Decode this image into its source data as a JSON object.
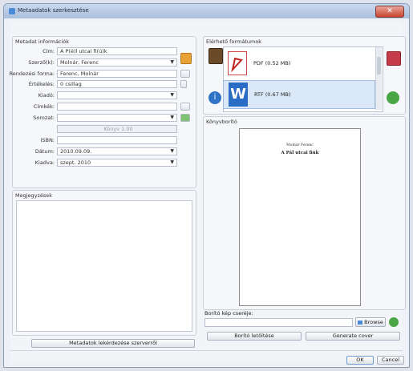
{
  "window": {
    "title": "Metaadatok szerkesztése",
    "close_glyph": "✕"
  },
  "metadata": {
    "group_title": "Metadat információk",
    "fields": {
      "title_label": "Cím:",
      "title_value": "A P(é)l utcai fi(ú)k",
      "authors_label": "Szerző(k):",
      "authors_value": "Molnár, Ferenc",
      "sort_label": "Rendezési forma:",
      "sort_value": "Ferenc, Molnár",
      "rating_label": "Értékelés:",
      "rating_value": "0 csillag",
      "publisher_label": "Kiadó:",
      "publisher_value": "",
      "tags_label": "Címkék:",
      "tags_value": "",
      "series_label": "Sorozat:",
      "series_value": "",
      "series_number_value": "Könyv 1.00",
      "isbn_label": "ISBN:",
      "isbn_value": "",
      "date_label": "Dátum:",
      "date_value": "2010.09.09.",
      "published_label": "Kiadva:",
      "published_value": "szept. 2010"
    }
  },
  "comments": {
    "group_title": "Megjegyzések"
  },
  "fetch_button": "Metadatok lekérdezése szerverről",
  "formats": {
    "group_title": "Elérhető formátumok",
    "items": [
      {
        "label": "PDF (0.52 MB)",
        "icon": "pdf-icon"
      },
      {
        "label": "RTF (0.67 MB)",
        "icon": "word-icon"
      }
    ]
  },
  "cover": {
    "group_title": "Könyvborító",
    "page_author": "Molnár Ferenc",
    "page_title": "A Pál utcai fiúk",
    "change_label": "Borító kép cseréje:",
    "browse_button": "Browse",
    "download_button": "Borító letöltése",
    "generate_button": "Generate cover"
  },
  "footer": {
    "ok_button": "OK",
    "cancel_button": "Cancel"
  },
  "colors": {
    "accent": "#4a8ad6",
    "pdf": "#c2241c",
    "word": "#2b6cc4",
    "green": "#3a9a3a"
  }
}
